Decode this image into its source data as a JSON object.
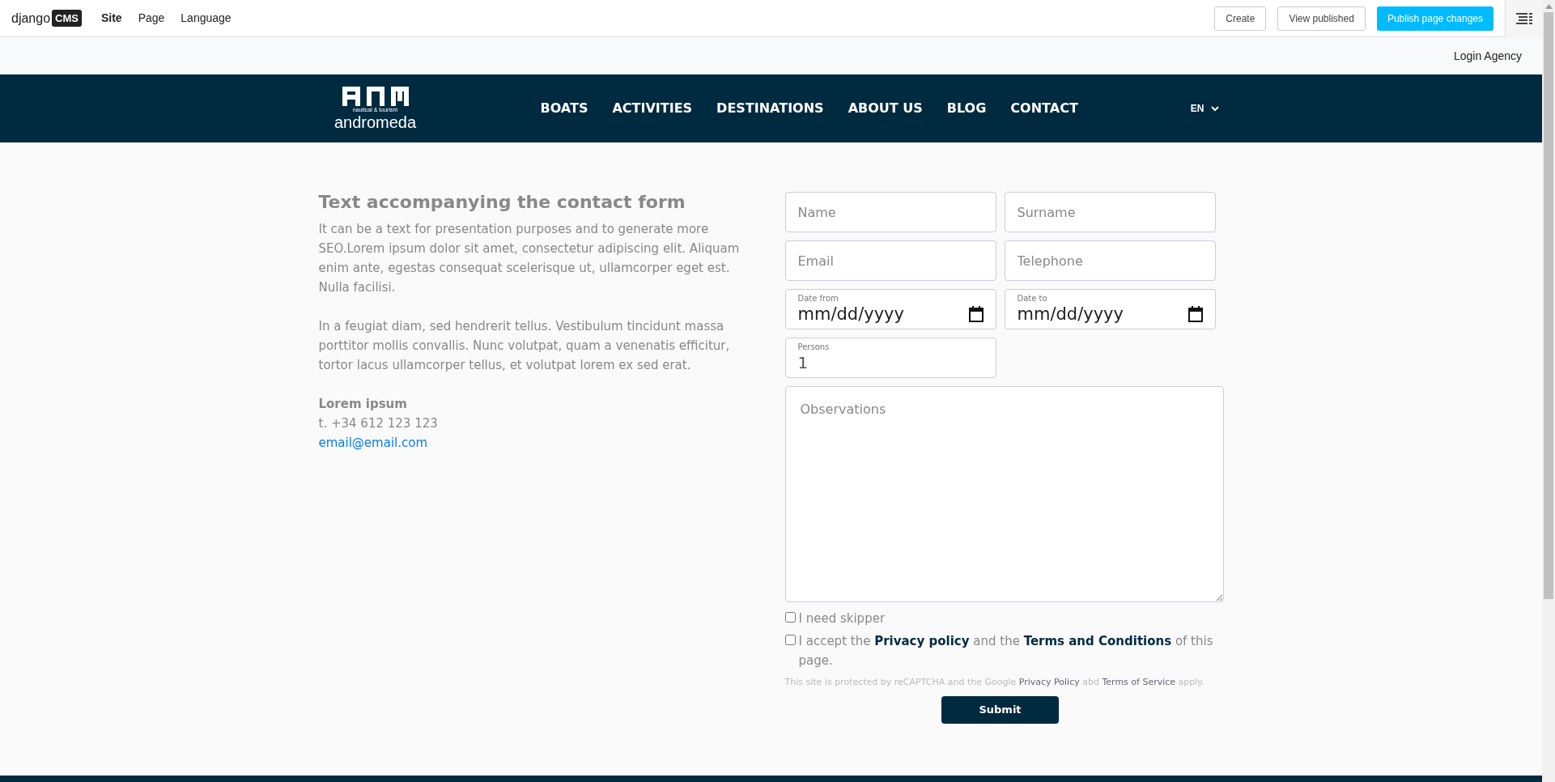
{
  "cms_toolbar": {
    "logo": {
      "text": "django",
      "badge": "CMS"
    },
    "menu": [
      "Site",
      "Page",
      "Language"
    ],
    "buttons": [
      {
        "label": "Create",
        "kind": "outline"
      },
      {
        "label": "View published",
        "kind": "outline"
      },
      {
        "label": "Publish page changes",
        "kind": "primary"
      }
    ]
  },
  "top_bar": {
    "link": "Login Agency"
  },
  "header": {
    "logo": {
      "tagline": "nautical & tourism",
      "name": "andromeda"
    },
    "nav": [
      "BOATS",
      "ACTIVITIES",
      "DESTINATIONS",
      "ABOUT US",
      "BLOG",
      "CONTACT"
    ],
    "language": "EN"
  },
  "intro": {
    "title": "Text accompanying the contact form",
    "paragraphs": [
      "It can be a text for presentation purposes and to generate more SEO.Lorem ipsum dolor sit amet, consectetur adipiscing elit. Aliquam enim ante, egestas consequat scelerisque ut, ullamcorper eget est. Nulla facilisi.",
      "In a feugiat diam, sed hendrerit tellus. Vestibulum tincidunt massa porttitor mollis convallis. Nunc volutpat, quam a venenatis efficitur, tortor lacus ullamcorper tellus, et volutpat lorem ex sed erat."
    ],
    "contact_name": "Lorem ipsum",
    "phone": "t. +34 612 123 123",
    "email": "email@email.com"
  },
  "form": {
    "fields": [
      {
        "kind": "text",
        "placeholder": "Name"
      },
      {
        "kind": "text",
        "placeholder": "Surname"
      },
      {
        "kind": "text",
        "placeholder": "Email"
      },
      {
        "kind": "text",
        "placeholder": "Telephone"
      },
      {
        "kind": "date",
        "label": "Date from",
        "value": "mm/dd/yyyy"
      },
      {
        "kind": "date",
        "label": "Date to",
        "value": "mm/dd/yyyy"
      },
      {
        "kind": "number",
        "label": "Persons",
        "value": "1"
      }
    ],
    "observations": {
      "placeholder": "Observations"
    },
    "checkboxes": [
      {
        "checked": false,
        "segments": [
          {
            "kind": "text",
            "text": "I need skipper"
          }
        ]
      },
      {
        "checked": false,
        "segments": [
          {
            "kind": "text",
            "text": "I accept the "
          },
          {
            "kind": "link",
            "text": "Privacy policy"
          },
          {
            "kind": "text",
            "text": " and the "
          },
          {
            "kind": "link",
            "text": "Terms and Conditions"
          },
          {
            "kind": "text",
            "text": " of this page."
          }
        ]
      }
    ],
    "recaptcha": [
      {
        "kind": "text",
        "text": "This site is protected by reCAPTCHA and the Google "
      },
      {
        "kind": "link",
        "text": "Privacy Policy"
      },
      {
        "kind": "text",
        "text": " abd "
      },
      {
        "kind": "link",
        "text": "Terms of Service"
      },
      {
        "kind": "text",
        "text": " apply."
      }
    ],
    "submit": "Submit"
  }
}
